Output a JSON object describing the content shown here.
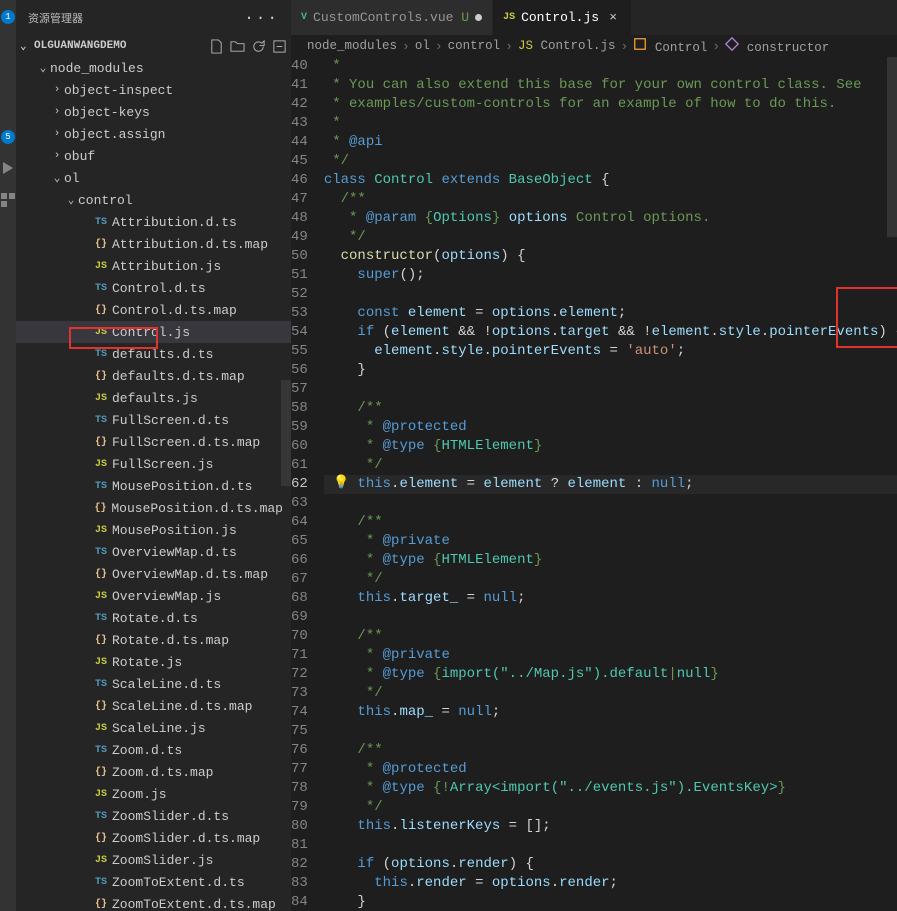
{
  "activity": {
    "badge1": "1",
    "badge2": "5"
  },
  "sidebar": {
    "title": "资源管理器",
    "project": "OLGUANWANGDEMO",
    "tree": [
      {
        "depth": 1,
        "kind": "folder",
        "expanded": true,
        "label": "node_modules"
      },
      {
        "depth": 2,
        "kind": "folder",
        "expanded": false,
        "label": "object-inspect"
      },
      {
        "depth": 2,
        "kind": "folder",
        "expanded": false,
        "label": "object-keys"
      },
      {
        "depth": 2,
        "kind": "folder",
        "expanded": false,
        "label": "object.assign"
      },
      {
        "depth": 2,
        "kind": "folder",
        "expanded": false,
        "label": "obuf"
      },
      {
        "depth": 2,
        "kind": "folder",
        "expanded": true,
        "label": "ol"
      },
      {
        "depth": 3,
        "kind": "folder",
        "expanded": true,
        "label": "control"
      },
      {
        "depth": 4,
        "kind": "file-ts",
        "label": "Attribution.d.ts"
      },
      {
        "depth": 4,
        "kind": "file-map",
        "label": "Attribution.d.ts.map"
      },
      {
        "depth": 4,
        "kind": "file-js",
        "label": "Attribution.js"
      },
      {
        "depth": 4,
        "kind": "file-ts",
        "label": "Control.d.ts"
      },
      {
        "depth": 4,
        "kind": "file-map",
        "label": "Control.d.ts.map"
      },
      {
        "depth": 4,
        "kind": "file-js",
        "label": "Control.js",
        "selected": true
      },
      {
        "depth": 4,
        "kind": "file-ts",
        "label": "defaults.d.ts"
      },
      {
        "depth": 4,
        "kind": "file-map",
        "label": "defaults.d.ts.map"
      },
      {
        "depth": 4,
        "kind": "file-js",
        "label": "defaults.js"
      },
      {
        "depth": 4,
        "kind": "file-ts",
        "label": "FullScreen.d.ts"
      },
      {
        "depth": 4,
        "kind": "file-map",
        "label": "FullScreen.d.ts.map"
      },
      {
        "depth": 4,
        "kind": "file-js",
        "label": "FullScreen.js"
      },
      {
        "depth": 4,
        "kind": "file-ts",
        "label": "MousePosition.d.ts"
      },
      {
        "depth": 4,
        "kind": "file-map",
        "label": "MousePosition.d.ts.map"
      },
      {
        "depth": 4,
        "kind": "file-js",
        "label": "MousePosition.js"
      },
      {
        "depth": 4,
        "kind": "file-ts",
        "label": "OverviewMap.d.ts"
      },
      {
        "depth": 4,
        "kind": "file-map",
        "label": "OverviewMap.d.ts.map"
      },
      {
        "depth": 4,
        "kind": "file-js",
        "label": "OverviewMap.js"
      },
      {
        "depth": 4,
        "kind": "file-ts",
        "label": "Rotate.d.ts"
      },
      {
        "depth": 4,
        "kind": "file-map",
        "label": "Rotate.d.ts.map"
      },
      {
        "depth": 4,
        "kind": "file-js",
        "label": "Rotate.js"
      },
      {
        "depth": 4,
        "kind": "file-ts",
        "label": "ScaleLine.d.ts"
      },
      {
        "depth": 4,
        "kind": "file-map",
        "label": "ScaleLine.d.ts.map"
      },
      {
        "depth": 4,
        "kind": "file-js",
        "label": "ScaleLine.js"
      },
      {
        "depth": 4,
        "kind": "file-ts",
        "label": "Zoom.d.ts"
      },
      {
        "depth": 4,
        "kind": "file-map",
        "label": "Zoom.d.ts.map"
      },
      {
        "depth": 4,
        "kind": "file-js",
        "label": "Zoom.js"
      },
      {
        "depth": 4,
        "kind": "file-ts",
        "label": "ZoomSlider.d.ts"
      },
      {
        "depth": 4,
        "kind": "file-map",
        "label": "ZoomSlider.d.ts.map"
      },
      {
        "depth": 4,
        "kind": "file-js",
        "label": "ZoomSlider.js"
      },
      {
        "depth": 4,
        "kind": "file-ts",
        "label": "ZoomToExtent.d.ts"
      },
      {
        "depth": 4,
        "kind": "file-map",
        "label": "ZoomToExtent.d.ts.map"
      }
    ]
  },
  "tabs": [
    {
      "icon": "vue",
      "label": "CustomControls.vue",
      "suffix": "U",
      "modified": true,
      "active": false
    },
    {
      "icon": "js",
      "label": "Control.js",
      "active": true
    }
  ],
  "breadcrumbs": [
    {
      "kind": "folder",
      "label": "node_modules"
    },
    {
      "kind": "folder",
      "label": "ol"
    },
    {
      "kind": "folder",
      "label": "control"
    },
    {
      "kind": "file-js",
      "label": "Control.js"
    },
    {
      "kind": "class",
      "label": "Control"
    },
    {
      "kind": "method",
      "label": "constructor"
    }
  ],
  "code": {
    "startLine": 40,
    "currentLine": 62,
    "lines": [
      {
        "n": 40,
        "html": " <span class='tok-doc'>*</span>"
      },
      {
        "n": 41,
        "html": " <span class='tok-doc'>* You can also extend this base for your own control class. See</span>"
      },
      {
        "n": 42,
        "html": " <span class='tok-doc'>* examples/custom-controls for an example of how to do this.</span>"
      },
      {
        "n": 43,
        "html": " <span class='tok-doc'>*</span>"
      },
      {
        "n": 44,
        "html": " <span class='tok-doc'>* </span><span class='tok-doctag'>@api</span>"
      },
      {
        "n": 45,
        "html": " <span class='tok-doc'>*/</span>"
      },
      {
        "n": 46,
        "html": "<span class='tok-keyword'>class</span> <span class='tok-class'>Control</span> <span class='tok-keyword'>extends</span> <span class='tok-class'>BaseObject</span> <span class='tok-punct'>{</span>"
      },
      {
        "n": 47,
        "html": "  <span class='tok-doc'>/**</span>"
      },
      {
        "n": 48,
        "html": "   <span class='tok-doc'>* </span><span class='tok-doctag'>@param</span><span class='tok-doc'> {</span><span class='tok-doctype'>Options</span><span class='tok-doc'>} </span><span class='tok-var'>options</span><span class='tok-doc'> Control options.</span>"
      },
      {
        "n": 49,
        "html": "   <span class='tok-doc'>*/</span>"
      },
      {
        "n": 50,
        "html": "  <span class='tok-func'>constructor</span><span class='tok-punct'>(</span><span class='tok-param'>options</span><span class='tok-punct'>)</span> <span class='tok-punct'>{</span>"
      },
      {
        "n": 51,
        "html": "    <span class='tok-this'>super</span><span class='tok-punct'>();</span>"
      },
      {
        "n": 52,
        "html": ""
      },
      {
        "n": 53,
        "html": "    <span class='tok-keyword'>const</span> <span class='tok-var'>element</span> <span class='tok-punct'>=</span> <span class='tok-var'>options</span><span class='tok-punct'>.</span><span class='tok-prop'>element</span><span class='tok-punct'>;</span>"
      },
      {
        "n": 54,
        "html": "    <span class='tok-keyword'>if</span> <span class='tok-punct'>(</span><span class='tok-var'>element</span> <span class='tok-punct'>&amp;&amp;</span> <span class='tok-punct'>!</span><span class='tok-var'>options</span><span class='tok-punct'>.</span><span class='tok-prop'>target</span> <span class='tok-punct'>&amp;&amp;</span> <span class='tok-punct'>!</span><span class='tok-var'>element</span><span class='tok-punct'>.</span><span class='tok-prop'>style</span><span class='tok-punct'>.</span><span class='tok-prop'>pointerEvents</span><span class='tok-punct'>)</span> <span class='tok-punct'>{</span>"
      },
      {
        "n": 55,
        "html": "      <span class='tok-var'>element</span><span class='tok-punct'>.</span><span class='tok-prop'>style</span><span class='tok-punct'>.</span><span class='tok-prop'>pointerEvents</span> <span class='tok-punct'>=</span> <span class='tok-string'>'auto'</span><span class='tok-punct'>;</span>"
      },
      {
        "n": 56,
        "html": "    <span class='tok-punct'>}</span>"
      },
      {
        "n": 57,
        "html": ""
      },
      {
        "n": 58,
        "html": "    <span class='tok-doc'>/**</span>"
      },
      {
        "n": 59,
        "html": "     <span class='tok-doc'>* </span><span class='tok-doctag'>@protected</span>"
      },
      {
        "n": 60,
        "html": "     <span class='tok-doc'>* </span><span class='tok-doctag'>@type</span><span class='tok-doc'> {</span><span class='tok-doctype'>HTMLElement</span><span class='tok-doc'>}</span>"
      },
      {
        "n": 61,
        "html": "     <span class='tok-doc'>*/</span>"
      },
      {
        "n": 62,
        "html": "    <span class='tok-this'>this</span><span class='tok-punct'>.</span><span class='tok-prop'>element</span> <span class='tok-punct'>=</span> <span class='tok-var'>element</span> <span class='tok-punct'>?</span> <span class='tok-var'>element</span> <span class='tok-punct'>:</span> <span class='tok-null'>null</span><span class='tok-punct'>;</span>"
      },
      {
        "n": 63,
        "html": ""
      },
      {
        "n": 64,
        "html": "    <span class='tok-doc'>/**</span>"
      },
      {
        "n": 65,
        "html": "     <span class='tok-doc'>* </span><span class='tok-doctag'>@private</span>"
      },
      {
        "n": 66,
        "html": "     <span class='tok-doc'>* </span><span class='tok-doctag'>@type</span><span class='tok-doc'> {</span><span class='tok-doctype'>HTMLElement</span><span class='tok-doc'>}</span>"
      },
      {
        "n": 67,
        "html": "     <span class='tok-doc'>*/</span>"
      },
      {
        "n": 68,
        "html": "    <span class='tok-this'>this</span><span class='tok-punct'>.</span><span class='tok-prop'>target_</span> <span class='tok-punct'>=</span> <span class='tok-null'>null</span><span class='tok-punct'>;</span>"
      },
      {
        "n": 69,
        "html": ""
      },
      {
        "n": 70,
        "html": "    <span class='tok-doc'>/**</span>"
      },
      {
        "n": 71,
        "html": "     <span class='tok-doc'>* </span><span class='tok-doctag'>@private</span>"
      },
      {
        "n": 72,
        "html": "     <span class='tok-doc'>* </span><span class='tok-doctag'>@type</span><span class='tok-doc'> {</span><span class='tok-doctype'>import(&quot;../Map.js&quot;).default</span><span class='tok-doc'>|</span><span class='tok-doctype'>null</span><span class='tok-doc'>}</span>"
      },
      {
        "n": 73,
        "html": "     <span class='tok-doc'>*/</span>"
      },
      {
        "n": 74,
        "html": "    <span class='tok-this'>this</span><span class='tok-punct'>.</span><span class='tok-prop'>map_</span> <span class='tok-punct'>=</span> <span class='tok-null'>null</span><span class='tok-punct'>;</span>"
      },
      {
        "n": 75,
        "html": ""
      },
      {
        "n": 76,
        "html": "    <span class='tok-doc'>/**</span>"
      },
      {
        "n": 77,
        "html": "     <span class='tok-doc'>* </span><span class='tok-doctag'>@protected</span>"
      },
      {
        "n": 78,
        "html": "     <span class='tok-doc'>* </span><span class='tok-doctag'>@type</span><span class='tok-doc'> {!</span><span class='tok-doctype'>Array&lt;import(&quot;../events.js&quot;).EventsKey&gt;</span><span class='tok-doc'>}</span>"
      },
      {
        "n": 79,
        "html": "     <span class='tok-doc'>*/</span>"
      },
      {
        "n": 80,
        "html": "    <span class='tok-this'>this</span><span class='tok-punct'>.</span><span class='tok-prop'>listenerKeys</span> <span class='tok-punct'>=</span> <span class='tok-punct'>[];</span>"
      },
      {
        "n": 81,
        "html": ""
      },
      {
        "n": 82,
        "html": "    <span class='tok-keyword'>if</span> <span class='tok-punct'>(</span><span class='tok-var'>options</span><span class='tok-punct'>.</span><span class='tok-prop'>render</span><span class='tok-punct'>)</span> <span class='tok-punct'>{</span>"
      },
      {
        "n": 83,
        "html": "      <span class='tok-this'>this</span><span class='tok-punct'>.</span><span class='tok-prop'>render</span> <span class='tok-punct'>=</span> <span class='tok-var'>options</span><span class='tok-punct'>.</span><span class='tok-prop'>render</span><span class='tok-punct'>;</span>"
      },
      {
        "n": 84,
        "html": "    <span class='tok-punct'>}</span>"
      }
    ]
  }
}
